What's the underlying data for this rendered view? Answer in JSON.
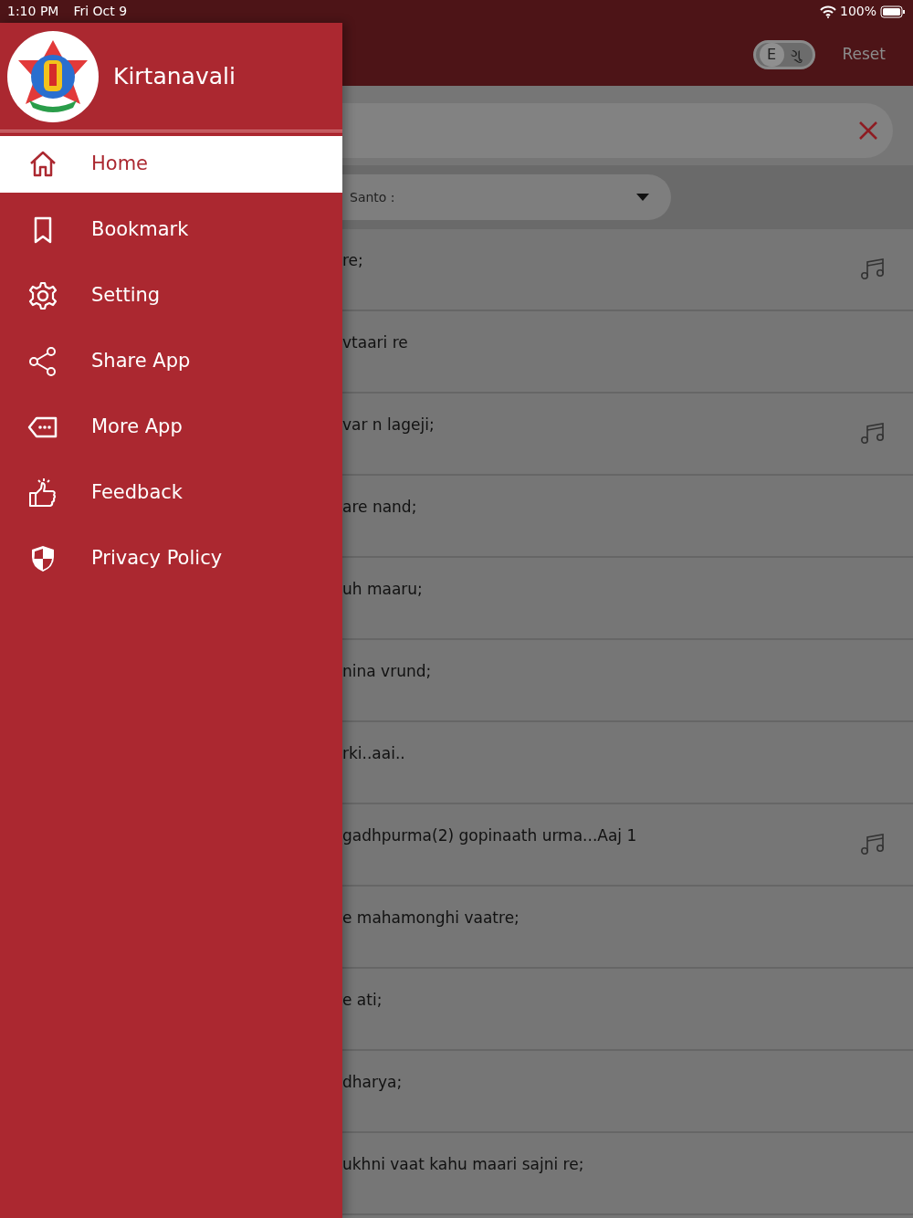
{
  "status_bar": {
    "time": "1:10 PM",
    "date": "Fri Oct 9",
    "battery": "100%"
  },
  "drawer": {
    "app_name": "Kirtanavali",
    "items": [
      {
        "label": "Home",
        "kind": "home",
        "selected": true
      },
      {
        "label": "Bookmark",
        "kind": "bookmark",
        "selected": false
      },
      {
        "label": "Setting",
        "kind": "gear",
        "selected": false
      },
      {
        "label": "Share App",
        "kind": "share",
        "selected": false
      },
      {
        "label": "More App",
        "kind": "more",
        "selected": false
      },
      {
        "label": "Feedback",
        "kind": "thumb",
        "selected": false
      },
      {
        "label": "Privacy Policy",
        "kind": "shield",
        "selected": false
      }
    ]
  },
  "header": {
    "language_toggle": [
      {
        "label": "E",
        "selected": true
      },
      {
        "label": "ગુ",
        "selected": false
      }
    ],
    "reset": "Reset"
  },
  "filter": {
    "label": "Santo :"
  },
  "rows": [
    {
      "text": "re;",
      "audio": true
    },
    {
      "text": "vtaari re",
      "audio": false
    },
    {
      "text": "var n lageji;",
      "audio": true
    },
    {
      "text": "are nand;",
      "audio": false
    },
    {
      "text": "uh maaru;",
      "audio": false
    },
    {
      "text": "nina vrund;",
      "audio": false
    },
    {
      "text": "rki..aai..",
      "audio": false
    },
    {
      "text": "gadhpurma(2) gopinaath urma...Aaj 1",
      "audio": true
    },
    {
      "text": "e mahamonghi vaatre;",
      "audio": false
    },
    {
      "text": "e ati;",
      "audio": false
    },
    {
      "text": "dharya;",
      "audio": false
    },
    {
      "text": "ukhni vaat kahu maari sajni re;",
      "audio": false
    }
  ]
}
